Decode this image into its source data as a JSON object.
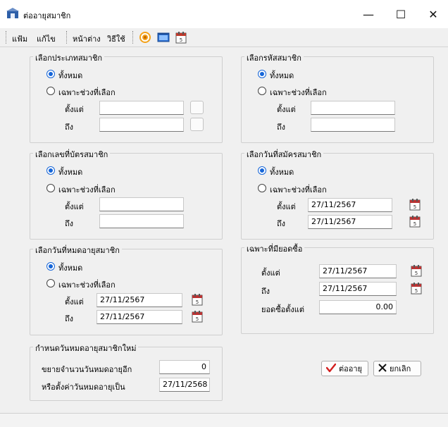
{
  "window": {
    "title": "ต่ออายุสมาชิก",
    "controls": {
      "minimize": "—",
      "maximize": "☐",
      "close": "✕"
    }
  },
  "toolbar": {
    "file": "แฟ้ม",
    "edit": "แก้ไข",
    "window": "หน้าต่าง",
    "help": "วิธีใช้",
    "icons": [
      "refresh-icon",
      "screen-icon",
      "calendar-icon"
    ]
  },
  "radio_all": "ทั้งหมด",
  "radio_range": "เฉพาะช่วงที่เลือก",
  "label_from": "ตั้งแต่",
  "label_to": "ถึง",
  "groups": {
    "member_type": {
      "title": "เลือกประเภทสมาชิก",
      "selected": "all",
      "from": "",
      "to": ""
    },
    "member_code": {
      "title": "เลือกรหัสสมาชิก",
      "selected": "all",
      "from": "",
      "to": ""
    },
    "card_number": {
      "title": "เลือกเลขที่บัตรสมาชิก",
      "selected": "all",
      "from": "",
      "to": ""
    },
    "apply_date": {
      "title": "เลือกวันที่สมัครสมาชิก",
      "selected": "all",
      "from": "27/11/2567",
      "to": "27/11/2567"
    },
    "expire_date": {
      "title": "เลือกวันที่หมดอายุสมาชิก",
      "selected": "all",
      "from": "27/11/2567",
      "to": "27/11/2567"
    },
    "has_purchase": {
      "title": "เฉพาะที่มียอดซื้อ",
      "from": "27/11/2567",
      "to": "27/11/2567",
      "min_label": "ยอดซื้อตั้งแต่",
      "min_value": "0.00"
    },
    "new_expire": {
      "title": "กำหนดวันหมดอายุสมาชิกใหม่",
      "extend_label": "ขยายจำนวนวันหมดอายุอีก",
      "extend_value": "0",
      "set_label": "หรือตั้งค่าวันหมดอายุเป็น",
      "set_value": "27/11/2568"
    }
  },
  "buttons": {
    "renew": "ต่ออายุ",
    "cancel": "ยกเลิก"
  },
  "colors": {
    "accent": "#1565d8",
    "renew_check": "#d21f1f"
  }
}
